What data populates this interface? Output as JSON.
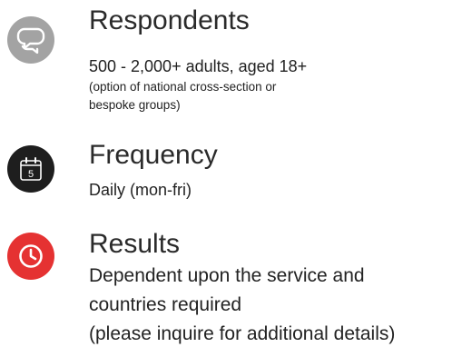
{
  "items": [
    {
      "icon": "chat-bubbles-icon",
      "color": "#a3a3a3",
      "title": "Respondents",
      "main": "500 - 2,000+ adults, aged 18+",
      "sub_lines": [
        "(option of national cross-section or",
        "bespoke groups)"
      ]
    },
    {
      "icon": "calendar-icon",
      "color": "#1e1e1e",
      "calendar_day": "5",
      "title": "Frequency",
      "main": "Daily (mon-fri)"
    },
    {
      "icon": "clock-icon",
      "color": "#e53232",
      "title": "Results",
      "body_lines": [
        "Dependent upon the service and",
        "countries required",
        "(please inquire for additional details)"
      ]
    }
  ]
}
